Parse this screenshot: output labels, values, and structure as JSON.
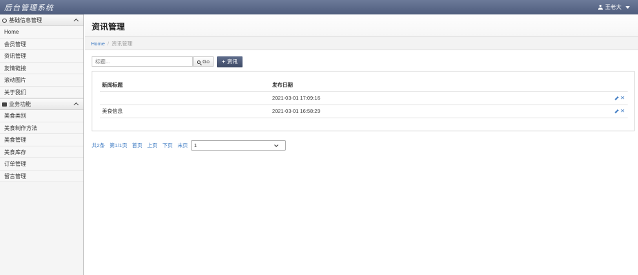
{
  "app": {
    "title": "后台管理系统"
  },
  "user": {
    "name": "王老大"
  },
  "sidebar": {
    "groups": [
      {
        "label": "基础信息管理",
        "icon": "gear-icon",
        "items": [
          "Home",
          "会员管理",
          "资讯管理",
          "友情链接",
          "滚动图片",
          "关于我们"
        ]
      },
      {
        "label": "业务功能",
        "icon": "folder-icon",
        "items": [
          "美食类别",
          "美食制作方法",
          "美食管理",
          "美食库存",
          "订单管理",
          "留言管理"
        ]
      }
    ]
  },
  "page": {
    "title": "资讯管理"
  },
  "breadcrumb": {
    "home": "Home",
    "current": "资讯管理"
  },
  "toolbar": {
    "search_placeholder": "标题...",
    "go_label": "Go",
    "add_label": "资讯"
  },
  "table": {
    "headers": [
      "新闻标题",
      "发布日期"
    ],
    "rows": [
      {
        "title": "",
        "date": "2021-03-01 17:09:16"
      },
      {
        "title": "美食信息",
        "date": "2021-03-01 16:58:29"
      }
    ]
  },
  "pagination": {
    "total": "共2条",
    "page": "第1/1页",
    "first": "首页",
    "prev": "上页",
    "next": "下页",
    "last": "末页",
    "selected": "1"
  },
  "colors": {
    "topbar": "#5a6785",
    "link": "#3a78c2",
    "add_button": "#4a5672"
  }
}
